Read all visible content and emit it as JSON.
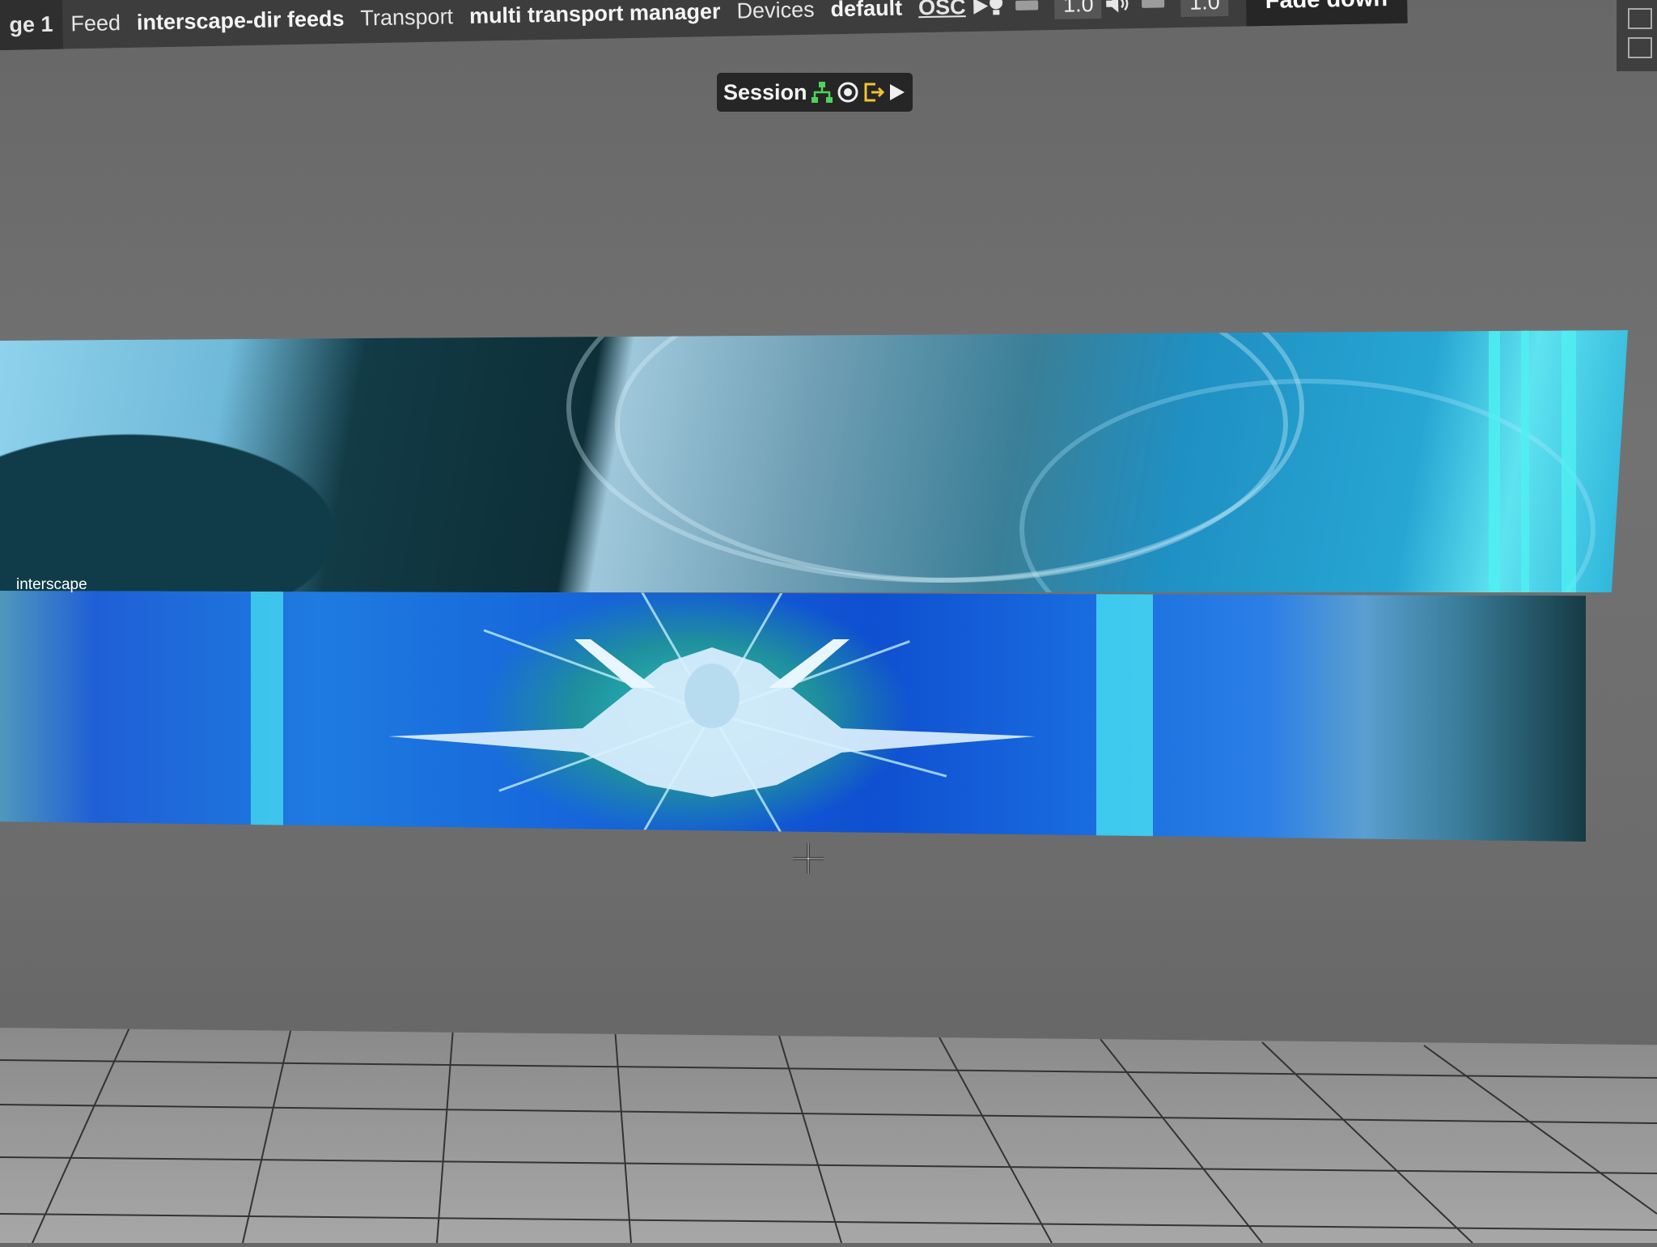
{
  "toolbar": {
    "page_label": "ge 1",
    "items": [
      "Feed",
      "interscape-dir feeds",
      "Transport",
      "multi transport manager",
      "Devices",
      "default"
    ],
    "osc_label": "OSC",
    "brightness_value": "1.0",
    "volume_value": "1.0",
    "fade_label": "Fade down",
    "icons": [
      "play-icon",
      "bulb-icon",
      "speaker-icon"
    ]
  },
  "session": {
    "label": "Session",
    "icons": [
      "network-icon",
      "target-icon",
      "export-icon",
      "play-icon"
    ]
  },
  "canvas": {
    "strip_label": "interscape"
  },
  "colors": {
    "toolbar_bg": "#3d3d3d",
    "session_bg": "#262626",
    "network_icon": "#4fd35a",
    "export_icon": "#f2c230",
    "accent_cyan": "#4ff0f3"
  }
}
